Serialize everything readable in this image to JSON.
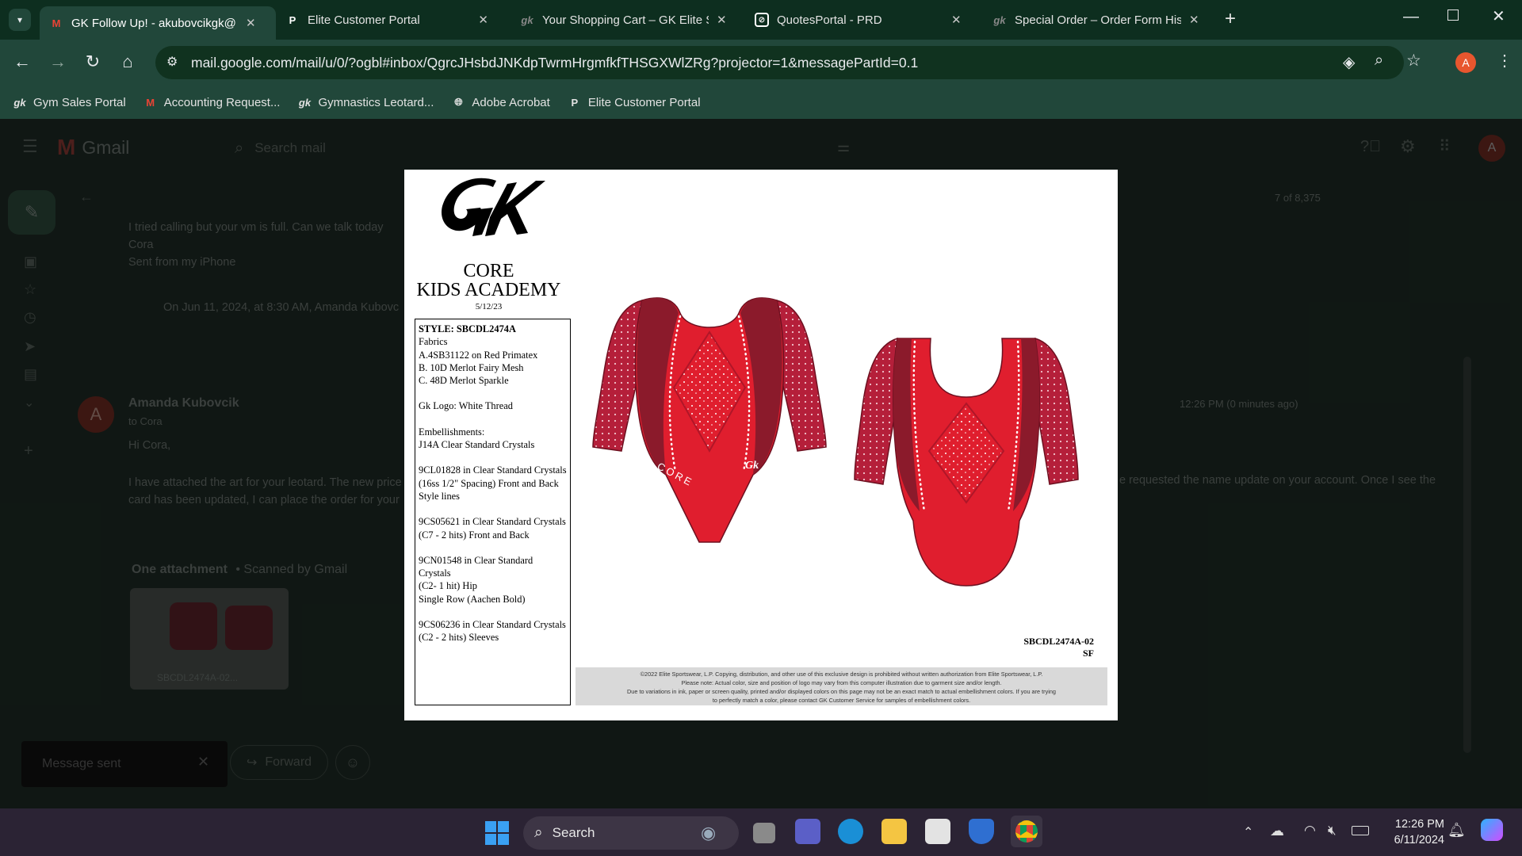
{
  "browser": {
    "tabs": [
      {
        "label": "GK Follow Up! - akubovcikgk@",
        "icon": "gmail-icon",
        "active": true
      },
      {
        "label": "Elite Customer Portal",
        "icon": "portal-p-icon"
      },
      {
        "label": "Your Shopping Cart – GK Elite S",
        "icon": "gk-icon"
      },
      {
        "label": "QuotesPortal - PRD",
        "icon": "quotes-icon"
      },
      {
        "label": "Special Order – Order Form His",
        "icon": "gk-icon"
      }
    ],
    "url": "mail.google.com/mail/u/0/?ogbl#inbox/QgrcJHsbdJNKdpTwrmHrgmfkfTHSGXWlZRg?projector=1&messagePartId=0.1",
    "profile_initial": "A",
    "bookmarks": [
      "Gym Sales Portal",
      "Accounting Request...",
      "Gymnastics Leotard...",
      "Adobe Acrobat",
      "Elite Customer Portal"
    ]
  },
  "gmail": {
    "app_name": "Gmail",
    "search_placeholder": "Search mail",
    "count": "7 of 8,375",
    "quoted_lines": [
      "I tried calling but your vm is full. Can we talk today",
      "Cora",
      "Sent from my iPhone"
    ],
    "quote_header": "On Jun 11, 2024, at 8:30 AM, Amanda Kubovc",
    "sender": "Amanda Kubovcik",
    "to": "to Cora",
    "time": "12:26 PM (0 minutes ago)",
    "greeting": "Hi Cora,",
    "body_left": "I have attached the art for your leotard. The new price",
    "body_left2": "card has been updated, I can place the order for your",
    "body_right": "e requested the name update on your account. Once I see the",
    "attachments_title": "One attachment",
    "scanned": "• Scanned by Gmail",
    "attachment_name": "SBCDL2474A-02...",
    "toast": "Message sent",
    "forward": "Forward",
    "avatar_initial": "A"
  },
  "viewer": {
    "logo": "Gk",
    "team_line1": "CORE",
    "team_line2": "KIDS ACADEMY",
    "date": "5/12/23",
    "spec_lines": [
      "STYLE: SBCDL2474A",
      "Fabrics\nA.4SB31122 on Red Primatex\nB. 10D Merlot Fairy Mesh\nC. 48D Merlot Sparkle",
      "Gk Logo: White Thread",
      "Embellishments:\nJ14A Clear Standard Crystals",
      "9CL01828 in Clear Standard Crystals\n(16ss 1/2\" Spacing) Front and Back Style lines",
      "9CS05621 in Clear Standard Crystals\n(C7 - 2 hits) Front and Back",
      "9CN01548 in Clear Standard Crystals\n(C2- 1 hit) Hip\nSingle Row (Aachen Bold)",
      "9CS06236 in Clear Standard Crystals\n(C2 - 2 hits) Sleeves"
    ],
    "hip_text": "CORE",
    "hip_logo": "Gk",
    "design_code": "SBCDL2474A-02",
    "design_sub": "SF",
    "disclaimer_lines": [
      "©2022 Elite Sportswear, L.P. Copying, distribution, and other use of this exclusive design is prohibited without written authorization from Elite Sportswear, L.P.",
      "Please note: Actual color, size and position of logo may vary from this computer illustration due to garment size and/or length.",
      "Due to variations in ink, paper or screen quality, printed and/or displayed colors on this page may not be an exact match to actual embellishment colors. If you are trying",
      "to perfectly match a color, please contact GK Customer Service for samples of embellishment colors."
    ]
  },
  "taskbar": {
    "search": "Search",
    "time": "12:26 PM",
    "date": "6/11/2024"
  },
  "colors": {
    "leo_red": "#e01e2e",
    "leo_merlot": "#8b1a2b",
    "sleeve": "#b51f3a",
    "chrome": "#21473a"
  }
}
